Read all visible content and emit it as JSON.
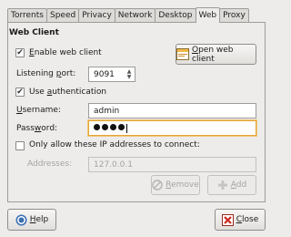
{
  "tabs": [
    {
      "label": "Torrents",
      "active": false
    },
    {
      "label": "Speed",
      "active": false
    },
    {
      "label": "Privacy",
      "active": false
    },
    {
      "label": "Network",
      "active": false
    },
    {
      "label": "Desktop",
      "active": false
    },
    {
      "label": "Web",
      "active": true
    },
    {
      "label": "Proxy",
      "active": false
    }
  ],
  "section": {
    "title": "Web Client"
  },
  "enable": {
    "label_before": "",
    "label_u": "E",
    "label_after": "nable web client",
    "checked": true,
    "check_mark": "✔"
  },
  "open_button": {
    "label_u": "O",
    "label_after": "pen web client"
  },
  "port": {
    "label_before": "Listening ",
    "label_u": "p",
    "label_after": "ort:",
    "value": "9091"
  },
  "auth": {
    "label_before": "Use ",
    "label_u": "a",
    "label_after": "uthentication",
    "checked": true,
    "check_mark": "✔"
  },
  "username": {
    "label_u": "U",
    "label_after": "sername:",
    "value": "admin"
  },
  "password": {
    "label_before": "Pass",
    "label_u": "w",
    "label_after": "ord:",
    "masked_count": 4
  },
  "ip_only": {
    "label": "Only allow these IP addresses to connect:",
    "checked": false
  },
  "addresses": {
    "label": "Addresses:",
    "value": "127.0.0.1"
  },
  "remove_button": {
    "label_u": "R",
    "label_after": "emove",
    "enabled": false
  },
  "add_button": {
    "label_u": "A",
    "label_after": "dd",
    "enabled": false
  },
  "help_button": {
    "label_u": "H",
    "label_after": "elp"
  },
  "close_button": {
    "label_u": "C",
    "label_after": "lose"
  },
  "colors": {
    "focus_border": "#e6a437",
    "close_icon": "#cc2a1f",
    "help_icon": "#3b6fb3"
  }
}
